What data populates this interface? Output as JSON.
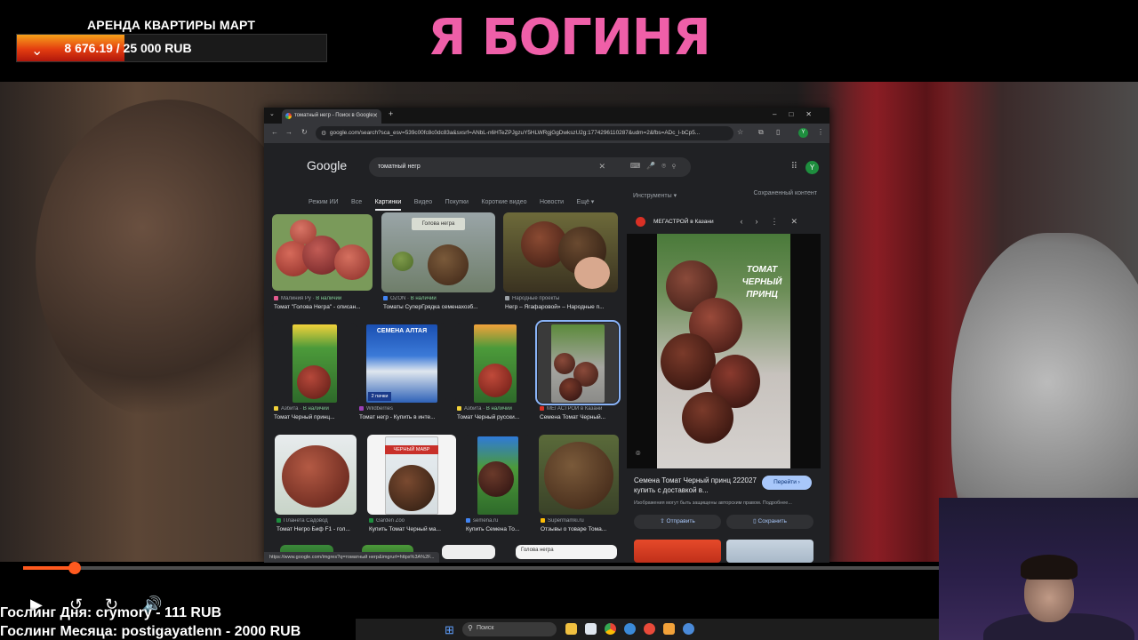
{
  "overlay": {
    "goal_title": "АРЕНДА КВАРТИРЫ МАРТ",
    "goal_progress": "8 676.19 / 25 000 RUB",
    "goal_fraction": 0.347,
    "headline": "Я БОГИНЯ"
  },
  "browser": {
    "tab_title": "томатный негр - Поиск в Google",
    "url": "google.com/search?sca_esv=539c00fc8c0dc83a&sxsrf=ANbL-n6HTeZPJgzuY5HLWRgjGgDwkszU2g:1774296110287&udm=2&fbs=ADc_l-bCp5...",
    "status_url": "https://www.google.com/imgres?q=томатный негр&imgrurl=https%3A%2F..."
  },
  "google": {
    "logo": "Google",
    "query": "томатный негр",
    "avatar_letter": "Y",
    "filters": [
      "Режим ИИ",
      "Все",
      "Картинки",
      "Видео",
      "Покупки",
      "Короткие видео",
      "Новости",
      "Ещё ▾"
    ],
    "tools": "Инструменты ▾",
    "saved": "Сохраненный контент",
    "results": [
      {
        "source": "Малиния Ру",
        "stock": "В наличии",
        "title": "Томат \"Голова Негра\" - описан..."
      },
      {
        "source": "OZON",
        "stock": "В наличии",
        "title": "Томаты СуперГрядка семенахозб..."
      },
      {
        "source": "Народные проекты",
        "stock": "",
        "title": "Негр – Ягафаровой» – Народные п..."
      },
      {
        "source": "Азбита",
        "stock": "В наличии",
        "title": "Томат Черный принц..."
      },
      {
        "source": "Wildberries",
        "stock": "",
        "title": "Томат негр - Купить в инте..."
      },
      {
        "source": "Азбита",
        "stock": "В наличии",
        "title": "Томат Черный русски..."
      },
      {
        "source": "МЕГАСТРОЙ в Казани",
        "stock": "",
        "title": "Семена Томат Черный..."
      },
      {
        "source": "Планета Садовод",
        "stock": "",
        "title": "Томат Негро Биф F1 - гол..."
      },
      {
        "source": "Garden Zoo",
        "stock": "",
        "title": "Купить Томат Черный ма..."
      },
      {
        "source": "semena.ru",
        "stock": "",
        "title": "Купить Семена То..."
      },
      {
        "source": "Supermamki.ru",
        "stock": "",
        "title": "Отзывы о товаре Тома..."
      }
    ],
    "pack_labels": {
      "altay": "СЕМЕНА АЛТАЯ",
      "altay_badge": "2 пачки",
      "black_moor": "ЧЕРНЫЙ МАВР",
      "golova": "Голова негра",
      "photo_caption": "Голова негра"
    },
    "panel": {
      "site": "МЕГАСТРОЙ в Казани",
      "image_caption": "ТОМАТ ЧЕРНЫЙ ПРИНЦ",
      "title": "Семена Томат Черный принц 222027 купить с доставкой в...",
      "go_button": "Перейти ›",
      "copyright": "Изображения могут быть защищены авторским правом. Подробнее...",
      "share": "Отправить",
      "save": "Сохранить"
    }
  },
  "player": {
    "progress_fraction": 0.056,
    "donor_day": "Гослинг Дня: crymory - 111 RUB",
    "donor_month": "Гослинг Месяца: postigayatlenn - 2000 RUB"
  },
  "taskbar": {
    "search_placeholder": "Поиск"
  },
  "colors": {
    "headline": "#ef5fa8",
    "progress": "#ff5a1f",
    "google_accent": "#8ab4f8"
  }
}
